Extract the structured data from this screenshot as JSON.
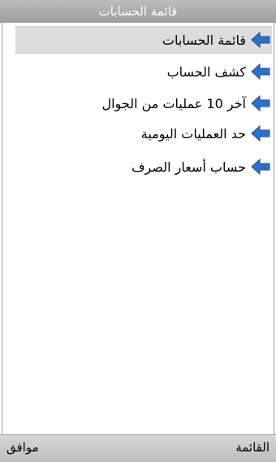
{
  "header": {
    "title": "قائمة الحسابات"
  },
  "menu": {
    "items": [
      {
        "label": "قائمة الحسابات",
        "icon": "arrow-left-icon",
        "selected": true
      },
      {
        "label": "كشف الحساب",
        "icon": "arrow-left-icon",
        "selected": false
      },
      {
        "label": "آخر 10 عمليات من الجوال",
        "icon": "arrow-left-icon",
        "selected": false
      },
      {
        "label": "حد العمليات اليومية",
        "icon": "arrow-left-icon",
        "selected": false
      },
      {
        "label": "حساب أسعار الصرف",
        "icon": "arrow-left-icon",
        "selected": false
      }
    ]
  },
  "softkeys": {
    "left": "موافق",
    "right": "القائمة"
  },
  "colors": {
    "arrow": "#2f6fc4",
    "selected_bg": "#dcdcdc",
    "title_bg": "#a8a8a8"
  }
}
